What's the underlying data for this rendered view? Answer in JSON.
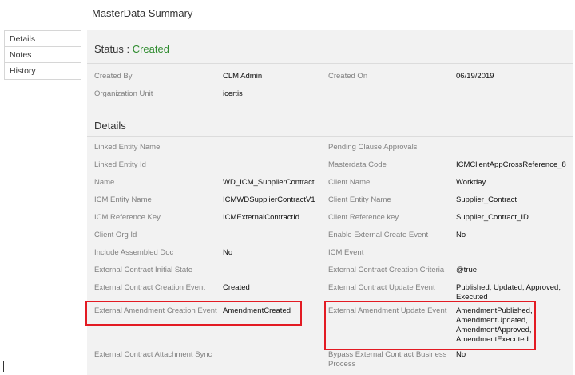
{
  "header": {
    "title": "MasterData Summary"
  },
  "nav": {
    "items": [
      "Details",
      "Notes",
      "History"
    ]
  },
  "status": {
    "label": "Status :",
    "value": "Created"
  },
  "summary": {
    "created_by_label": "Created By",
    "created_by_value": "CLM Admin",
    "created_on_label": "Created On",
    "created_on_value": "06/19/2019",
    "org_unit_label": "Organization Unit",
    "org_unit_value": "icertis"
  },
  "details": {
    "title": "Details",
    "left": [
      {
        "label": "Linked Entity Name",
        "value": ""
      },
      {
        "label": "Linked Entity Id",
        "value": ""
      },
      {
        "label": "Name",
        "value": "WD_ICM_SupplierContract"
      },
      {
        "label": "ICM Entity Name",
        "value": "ICMWDSupplierContractV1"
      },
      {
        "label": "ICM Reference Key",
        "value": "ICMExternalContractId"
      },
      {
        "label": "Client Org Id",
        "value": ""
      },
      {
        "label": "Include Assembled Doc",
        "value": "No"
      },
      {
        "label": "External Contract Initial State",
        "value": ""
      },
      {
        "label": "External Contract Creation Event",
        "value": "Created"
      },
      {
        "label": "External Amendment Creation Event",
        "value": "AmendmentCreated"
      },
      {
        "label": "External Contract Attachment Sync",
        "value": ""
      }
    ],
    "right": [
      {
        "label": "Pending Clause Approvals",
        "value": ""
      },
      {
        "label": "Masterdata Code",
        "value": "ICMClientAppCrossReference_8"
      },
      {
        "label": "Client Name",
        "value": "Workday"
      },
      {
        "label": "Client Entity Name",
        "value": "Supplier_Contract"
      },
      {
        "label": "Client Reference key",
        "value": "Supplier_Contract_ID"
      },
      {
        "label": "Enable External Create Event",
        "value": "No"
      },
      {
        "label": "ICM Event",
        "value": ""
      },
      {
        "label": "External Contract Creation Criteria",
        "value": "@true"
      },
      {
        "label": "External Contract Update Event",
        "value": "Published, Updated, Approved,\nExecuted"
      },
      {
        "label": "External Amendment Update Event",
        "value": "AmendmentPublished,\nAmendmentUpdated,\nAmendmentApproved,\nAmendmentExecuted"
      },
      {
        "label": "Bypass External Contract Business\nProcess",
        "value": "No"
      }
    ]
  },
  "colors": {
    "highlight": "#e31b23",
    "status_green": "#2e8b2e",
    "panel_bg": "#f2f2f2"
  }
}
